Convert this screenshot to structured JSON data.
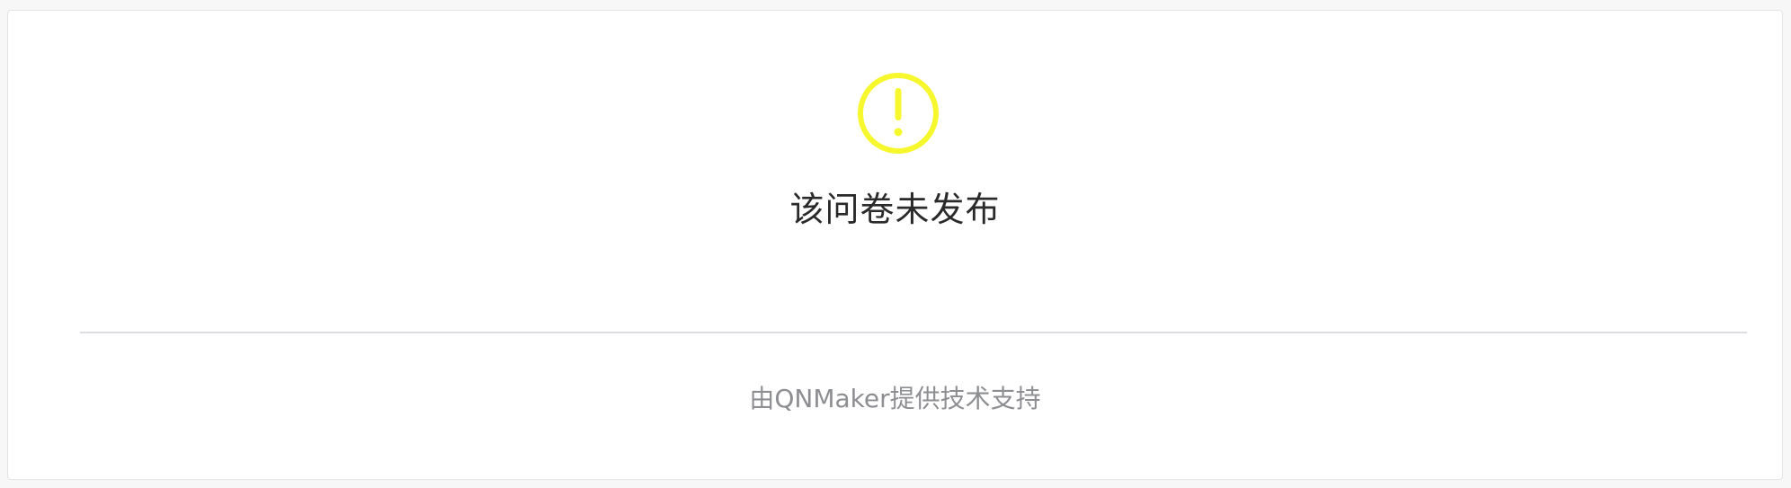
{
  "status": {
    "icon": "exclamation-circle-icon",
    "icon_color": "#f6f72c",
    "message": "该问卷未发布"
  },
  "footer": {
    "powered_by": "由QNMaker提供技术支持"
  }
}
